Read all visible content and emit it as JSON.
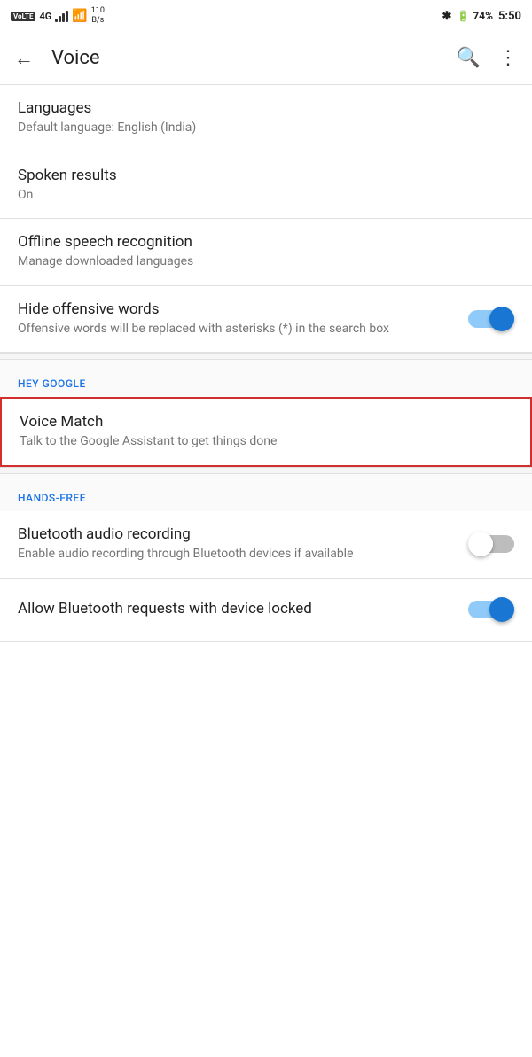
{
  "statusBar": {
    "left": {
      "volte": "VoLTE",
      "network": "4G",
      "speed": "110\nB/s"
    },
    "right": {
      "bluetooth": "✱",
      "battery": "74",
      "time": "5:50"
    }
  },
  "appBar": {
    "title": "Voice",
    "back_label": "←",
    "search_label": "🔍",
    "more_label": "⋮"
  },
  "settingsItems": [
    {
      "id": "languages",
      "title": "Languages",
      "subtitle": "Default language: English (India)",
      "hasToggle": false,
      "toggleOn": false,
      "sectionHeader": null
    },
    {
      "id": "spoken-results",
      "title": "Spoken results",
      "subtitle": "On",
      "hasToggle": false,
      "toggleOn": false,
      "sectionHeader": null
    },
    {
      "id": "offline-speech",
      "title": "Offline speech recognition",
      "subtitle": "Manage downloaded languages",
      "hasToggle": false,
      "toggleOn": false,
      "sectionHeader": null
    },
    {
      "id": "hide-offensive",
      "title": "Hide offensive words",
      "subtitle": "Offensive words will be replaced with asterisks (*) in the search box",
      "hasToggle": true,
      "toggleOn": true,
      "sectionHeader": null
    }
  ],
  "sections": {
    "heyGoogle": {
      "label": "HEY GOOGLE",
      "items": [
        {
          "id": "voice-match",
          "title": "Voice Match",
          "subtitle": "Talk to the Google Assistant to get things done",
          "hasToggle": false,
          "highlighted": true
        }
      ]
    },
    "handsFree": {
      "label": "HANDS-FREE",
      "items": [
        {
          "id": "bluetooth-audio",
          "title": "Bluetooth audio recording",
          "subtitle": "Enable audio recording through Bluetooth devices if available",
          "hasToggle": true,
          "toggleOn": false
        },
        {
          "id": "bluetooth-requests",
          "title": "Allow Bluetooth requests with device locked",
          "subtitle": "",
          "hasToggle": true,
          "toggleOn": true
        }
      ]
    }
  }
}
